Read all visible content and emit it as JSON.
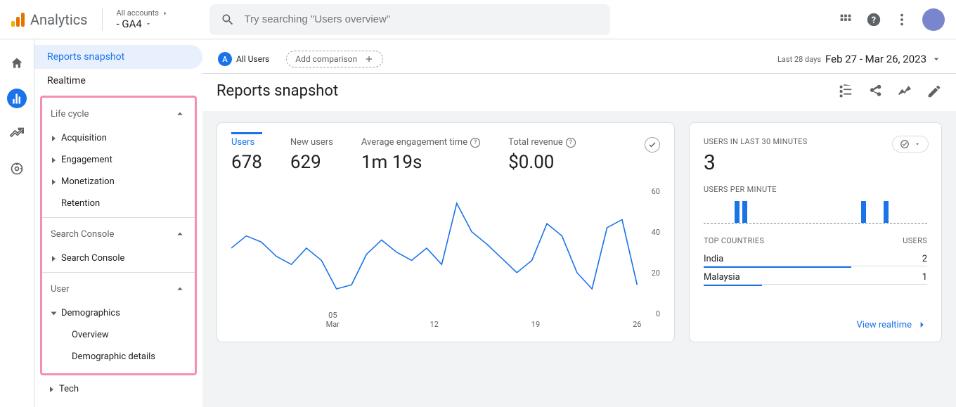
{
  "header": {
    "product": "Analytics",
    "account_label": "All accounts",
    "property": "- GA4",
    "search_placeholder": "Try searching \"Users overview\""
  },
  "sidebar": {
    "reports_snapshot": "Reports snapshot",
    "realtime": "Realtime",
    "life_cycle": {
      "title": "Life cycle",
      "items": [
        "Acquisition",
        "Engagement",
        "Monetization",
        "Retention"
      ]
    },
    "search_console": {
      "title": "Search Console",
      "items": [
        "Search Console"
      ]
    },
    "user": {
      "title": "User",
      "demographics": "Demographics",
      "overview": "Overview",
      "details": "Demographic details",
      "tech": "Tech"
    }
  },
  "filters": {
    "segment_badge": "A",
    "segment_name": "All Users",
    "add_comparison": "Add comparison",
    "date_label": "Last 28 days",
    "date_range": "Feb 27 - Mar 26, 2023"
  },
  "page": {
    "title": "Reports snapshot"
  },
  "metrics": {
    "users": {
      "label": "Users",
      "value": "678"
    },
    "new_users": {
      "label": "New users",
      "value": "629"
    },
    "avg_engagement": {
      "label": "Average engagement time",
      "value": "1m 19s"
    },
    "total_revenue": {
      "label": "Total revenue",
      "value": "$0.00"
    }
  },
  "realtime_card": {
    "title": "USERS IN LAST 30 MINUTES",
    "value": "3",
    "per_min_label": "USERS PER MINUTE",
    "countries_label": "TOP COUNTRIES",
    "users_col": "USERS",
    "countries": [
      {
        "name": "India",
        "users": "2",
        "barPct": 66
      },
      {
        "name": "Malaysia",
        "users": "1",
        "barPct": 26
      }
    ],
    "bars": [
      0,
      0,
      0,
      0,
      1,
      1,
      0,
      0,
      0,
      0,
      0,
      0,
      0,
      0,
      0,
      0,
      0,
      0,
      0,
      0,
      0,
      1,
      0,
      0,
      1,
      0,
      0,
      0,
      0,
      0
    ],
    "link": "View realtime"
  },
  "chart_data": {
    "type": "line",
    "title": "Users",
    "ylabel": "",
    "xlabel": "",
    "ylim": [
      0,
      60
    ],
    "yticks": [
      0,
      20,
      40,
      60
    ],
    "xticks": [
      {
        "label": "05",
        "sub": "Mar",
        "pos": 0.25
      },
      {
        "label": "12",
        "pos": 0.5
      },
      {
        "label": "19",
        "pos": 0.75
      },
      {
        "label": "26",
        "pos": 1.0
      }
    ],
    "series": [
      {
        "name": "Users",
        "color": "#1a73e8",
        "values": [
          30,
          36,
          33,
          26,
          22,
          30,
          24,
          10,
          12,
          27,
          34,
          28,
          24,
          30,
          22,
          52,
          38,
          32,
          25,
          18,
          24,
          42,
          36,
          18,
          10,
          40,
          44,
          12
        ]
      }
    ]
  }
}
